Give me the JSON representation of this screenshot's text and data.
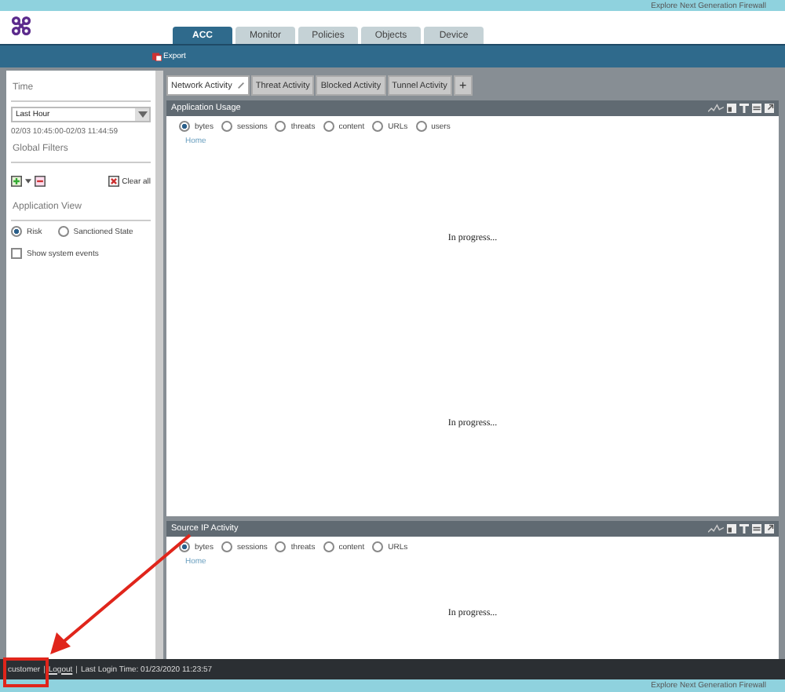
{
  "top_banner": {
    "text": "Explore Next Generation Firewall"
  },
  "nav_tabs": [
    {
      "label": "ACC",
      "selected": true
    },
    {
      "label": "Monitor",
      "selected": false
    },
    {
      "label": "Policies",
      "selected": false
    },
    {
      "label": "Objects",
      "selected": false
    },
    {
      "label": "Device",
      "selected": false
    }
  ],
  "toolbar": {
    "export": "Export"
  },
  "sidebar": {
    "time_heading": "Time",
    "time_range": "Last Hour",
    "time_span": "02/03 10:45:00-02/03 11:44:59",
    "filters_heading": "Global Filters",
    "clear_all": "Clear all",
    "view_heading": "Application View",
    "view_options": [
      {
        "label": "Risk",
        "selected": true
      },
      {
        "label": "Sanctioned State",
        "selected": false
      }
    ],
    "show_system_events": {
      "label": "Show system events",
      "checked": false
    }
  },
  "activity_tabs": [
    {
      "label": "Network Activity",
      "selected": true
    },
    {
      "label": "Threat Activity",
      "selected": false
    },
    {
      "label": "Blocked Activity",
      "selected": false
    },
    {
      "label": "Tunnel Activity",
      "selected": false
    }
  ],
  "add_tab": "+",
  "widgets": [
    {
      "title": "Application Usage",
      "options": [
        {
          "label": "bytes",
          "selected": true
        },
        {
          "label": "sessions",
          "selected": false
        },
        {
          "label": "threats",
          "selected": false
        },
        {
          "label": "content",
          "selected": false
        },
        {
          "label": "URLs",
          "selected": false
        },
        {
          "label": "users",
          "selected": false
        }
      ],
      "breadcrumb": "Home",
      "status": [
        "In progress...",
        "In progress..."
      ]
    },
    {
      "title": "Source IP Activity",
      "options": [
        {
          "label": "bytes",
          "selected": true
        },
        {
          "label": "sessions",
          "selected": false
        },
        {
          "label": "threats",
          "selected": false
        },
        {
          "label": "content",
          "selected": false
        },
        {
          "label": "URLs",
          "selected": false
        }
      ],
      "breadcrumb": "Home",
      "status": [
        "In progress..."
      ]
    }
  ],
  "status_bar": {
    "user": "customer",
    "separators": [
      "|",
      "|"
    ],
    "logout": "Logout",
    "last_login": "Last Login Time: 01/23/2020 11:23:57"
  },
  "bottom_banner": {
    "text": "Explore Next Generation Firewall"
  }
}
